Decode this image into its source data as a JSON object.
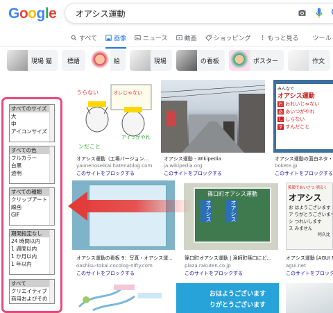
{
  "header": {
    "logo": {
      "letters": [
        "G",
        "o",
        "o",
        "g",
        "l",
        "e"
      ],
      "colors": [
        "#4285f4",
        "#ea4335",
        "#fbbc05",
        "#4285f4",
        "#34a853",
        "#ea4335"
      ]
    },
    "query": "オアシス運動"
  },
  "tabs": [
    {
      "label": "すべて",
      "icon": "search-icon",
      "active": false
    },
    {
      "label": "画像",
      "icon": "image-icon",
      "active": true
    },
    {
      "label": "ニュース",
      "icon": "news-icon",
      "active": false
    },
    {
      "label": "動画",
      "icon": "video-icon",
      "active": false
    },
    {
      "label": "ショッピング",
      "icon": "tag-icon",
      "active": false
    },
    {
      "label": "もっと見る",
      "icon": "more-icon",
      "active": false
    },
    {
      "label": "ツール",
      "icon": "",
      "active": false
    }
  ],
  "chips": [
    {
      "label": "現場 猫"
    },
    {
      "label": "標語"
    },
    {
      "label": "絵"
    },
    {
      "label": "現場"
    },
    {
      "label": "の看板"
    },
    {
      "label": "ポスター"
    },
    {
      "label": "作文"
    }
  ],
  "results": [
    {
      "title": "オアシス運動（工場バージョン...",
      "source": "yaonenoseikai.hatenablog.com",
      "block": "このサイトをブロックする"
    },
    {
      "title": "オアシス運動 - Wikipedia",
      "source": "ja.wikipedia.org",
      "block": "このサイトをブロックする"
    },
    {
      "title": "オアシス運動の面白ネタ・...",
      "source": "bokete.jp",
      "block": "このサイトをブロックする"
    },
    {
      "title": "オアシス運動の看板 9：写真・オアシス運...",
      "source": "oashisu-tokai.cocolog-nifty.com",
      "block": "このサイトをブロックする"
    },
    {
      "title": "篠口町オアシス運動 | 漁師町篠口にど...",
      "source": "plaza.rakuten.co.jp",
      "block": "このサイトをブロックする"
    },
    {
      "title": "オアシス運動 [AGUI N...",
      "source": "agui.net",
      "block": "このサイトをブロックする"
    }
  ],
  "signs": {
    "sign1": [
      "みんなで",
      "オアシス運動",
      "お",
      "おれいじゃない",
      "あ",
      "あいつがやれ",
      "し",
      "しらない",
      "す",
      "すんだこと"
    ],
    "sign2": [
      "篠口町オアシス運動",
      "オアシス",
      "オアシス"
    ],
    "sign3": [
      "笑顔であいさつ 明るく",
      "オアシス",
      "お はようございます",
      "ア りがとうございます",
      "シ つれいします",
      "ス みません",
      "阿久比"
    ],
    "sign4": [
      "おはようございます",
      "りがとうございます"
    ],
    "cats": [
      "うらない",
      "オレじゃない",
      "アイツがやれ",
      "ンだこと"
    ]
  },
  "filters": [
    {
      "name": "size-filter",
      "options": [
        "すべてのサイズ",
        "大",
        "中",
        "アイコンサイズ"
      ]
    },
    {
      "name": "color-filter",
      "options": [
        "すべての色",
        "フルカラー",
        "白黒",
        "透明"
      ]
    },
    {
      "name": "type-filter",
      "options": [
        "すべての種類",
        "クリップアート",
        "線画",
        "GIF"
      ]
    },
    {
      "name": "time-filter",
      "options": [
        "期間指定なし",
        "24 時間以内",
        "1 週間以内",
        "1 か月以内",
        "1 年以内"
      ]
    },
    {
      "name": "license-filter",
      "options": [
        "すべて",
        "クリエイティブ",
        "商用およびその"
      ]
    }
  ],
  "colors": {
    "accent": "#1a73e8",
    "panel_border": "#e8497a",
    "arrow": "#e53935"
  }
}
